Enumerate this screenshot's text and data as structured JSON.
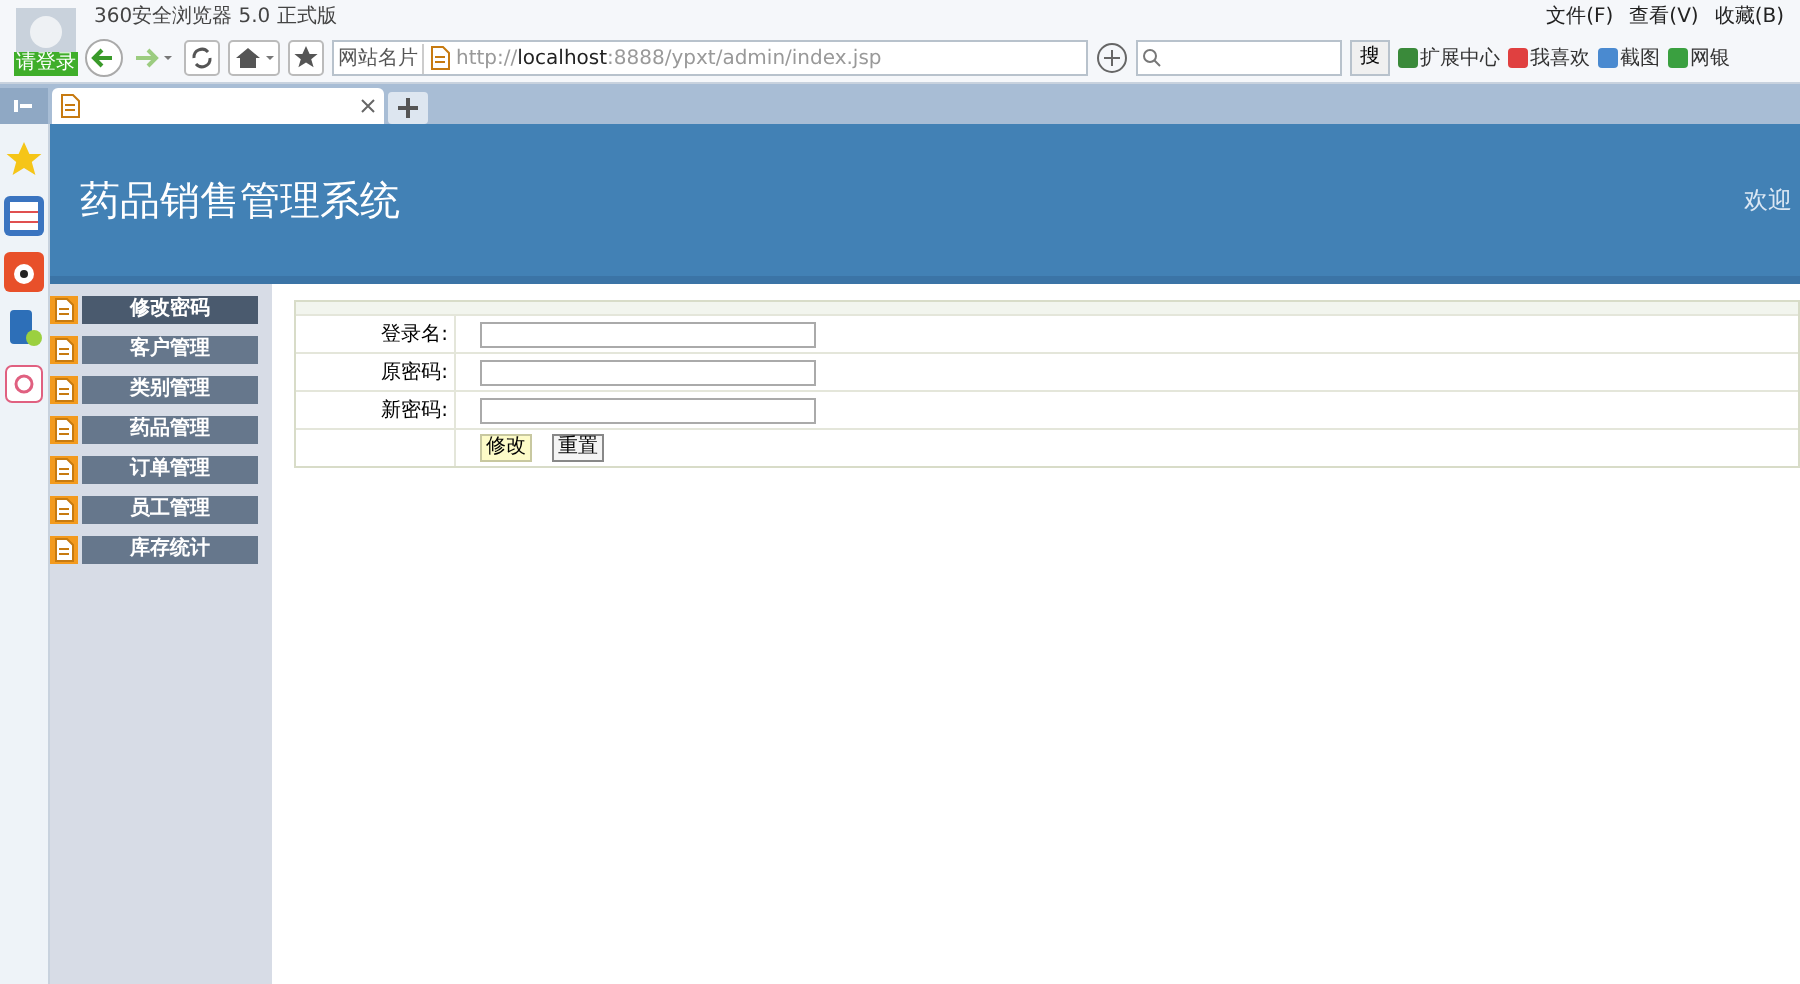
{
  "browser": {
    "title": "360安全浏览器 5.0 正式版",
    "login": "请登录",
    "menu": [
      "文件(F)",
      "查看(V)",
      "收藏(B)"
    ],
    "site_card": "网站名片",
    "url_prefix": "http://",
    "url_host": "localhost",
    "url_rest": ":8888/ypxt/admin/index.jsp",
    "search_button": "搜",
    "tools": [
      "扩展中心",
      "我喜欢",
      "截图",
      "网银"
    ]
  },
  "page": {
    "title": "药品销售管理系统",
    "welcome": "欢迎"
  },
  "sidebar": {
    "items": [
      {
        "label": "修改密码",
        "selected": true
      },
      {
        "label": "客户管理",
        "selected": false
      },
      {
        "label": "类别管理",
        "selected": false
      },
      {
        "label": "药品管理",
        "selected": false
      },
      {
        "label": "订单管理",
        "selected": false
      },
      {
        "label": "员工管理",
        "selected": false
      },
      {
        "label": "库存统计",
        "selected": false
      }
    ]
  },
  "form": {
    "fields": [
      {
        "label": "登录名:"
      },
      {
        "label": "原密码:"
      },
      {
        "label": "新密码:"
      }
    ],
    "buttons": [
      {
        "label": "修改",
        "kind": "primary"
      },
      {
        "label": "重置",
        "kind": "plain"
      }
    ]
  }
}
